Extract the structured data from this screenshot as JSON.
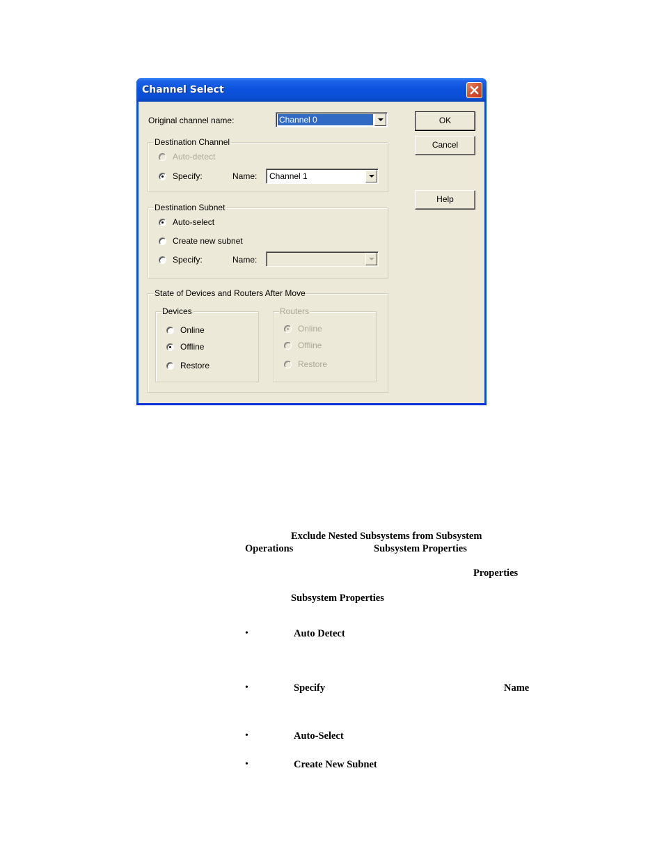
{
  "dialog": {
    "title": "Channel Select",
    "close_icon": "close-x-icon",
    "original_channel": {
      "label": "Original channel name:",
      "value": "Channel 0"
    },
    "destination_channel": {
      "title": "Destination Channel",
      "auto_detect_label": "Auto-detect",
      "specify_label": "Specify:",
      "name_label": "Name:",
      "name_value": "Channel 1",
      "selected": "specify"
    },
    "destination_subnet": {
      "title": "Destination Subnet",
      "auto_select_label": "Auto-select",
      "create_new_label": "Create new subnet",
      "specify_label": "Specify:",
      "name_label": "Name:",
      "name_value": "",
      "selected": "auto-select"
    },
    "state_after_move": {
      "title": "State of Devices and Routers After Move",
      "devices": {
        "title": "Devices",
        "options": [
          "Online",
          "Offline",
          "Restore"
        ],
        "selected": "Offline"
      },
      "routers": {
        "title": "Routers",
        "options": [
          "Online",
          "Offline",
          "Restore"
        ],
        "selected": "Online",
        "enabled": false
      }
    },
    "buttons": {
      "ok": "OK",
      "cancel": "Cancel",
      "help": "Help"
    }
  },
  "document": {
    "line1": "Exclude Nested Subsystems from Subsystem",
    "line2a": "Operations",
    "line2b": "Subsystem Properties",
    "line3": "Properties",
    "line4": "Subsystem Properties",
    "bullets": [
      {
        "bullet": "•",
        "term": "Auto Detect",
        "extra": ""
      },
      {
        "bullet": "•",
        "term": "Specify",
        "extra": "Name"
      },
      {
        "bullet": "•",
        "term": "Auto-Select",
        "extra": ""
      },
      {
        "bullet": "•",
        "term": "Create New Subnet",
        "extra": ""
      }
    ]
  }
}
